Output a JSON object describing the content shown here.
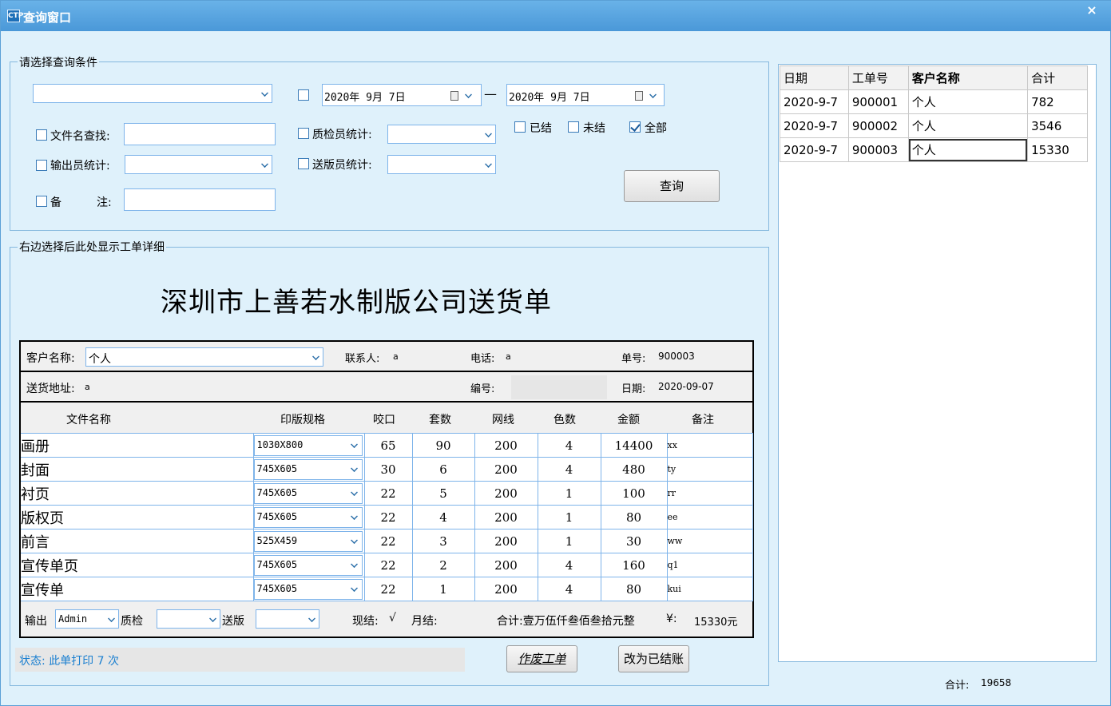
{
  "window": {
    "title": "查询窗口",
    "icon_text": "CTP",
    "close": "×"
  },
  "query": {
    "group_label": "请选择查询条件",
    "date_from": "2020年 9月 7日",
    "date_sep": "—",
    "date_to": "2020年 9月 7日",
    "filename_label": "文件名查找:",
    "qc_label": "质检员统计:",
    "output_label": "输出员统计:",
    "delivery_label": "送版员统计:",
    "remark_label_a": "备",
    "remark_label_b": "注:",
    "settled_label": "已结",
    "unsettled_label": "未结",
    "all_label": "全部",
    "search_button": "查询"
  },
  "detail": {
    "group_label": "右边选择后此处显示工单详细",
    "title": "深圳市上善若水制版公司送货单",
    "customer_label": "客户名称:",
    "customer_value": "个人",
    "contact_label": "联系人:",
    "contact_value": "a",
    "phone_label": "电话:",
    "phone_value": "a",
    "order_no_label": "单号:",
    "order_no_value": "900003",
    "address_label": "送货地址:",
    "address_value": "a",
    "code_label": "编号:",
    "date_label": "日期:",
    "date_value": "2020-09-07",
    "columns": [
      "文件名称",
      "印版规格",
      "咬口",
      "套数",
      "网线",
      "色数",
      "金额",
      "备注"
    ],
    "rows": [
      {
        "name": "画册",
        "spec": "1030X800",
        "bite": "65",
        "sets": "90",
        "screen": "200",
        "colors": "4",
        "amount": "14400",
        "note": "xx"
      },
      {
        "name": "封面",
        "spec": "745X605",
        "bite": "30",
        "sets": "6",
        "screen": "200",
        "colors": "4",
        "amount": "480",
        "note": "ty"
      },
      {
        "name": "衬页",
        "spec": "745X605",
        "bite": "22",
        "sets": "5",
        "screen": "200",
        "colors": "1",
        "amount": "100",
        "note": "rr"
      },
      {
        "name": "版权页",
        "spec": "745X605",
        "bite": "22",
        "sets": "4",
        "screen": "200",
        "colors": "1",
        "amount": "80",
        "note": "ee"
      },
      {
        "name": "前言",
        "spec": "525X459",
        "bite": "22",
        "sets": "3",
        "screen": "200",
        "colors": "1",
        "amount": "30",
        "note": "ww"
      },
      {
        "name": "宣传单页",
        "spec": "745X605",
        "bite": "22",
        "sets": "2",
        "screen": "200",
        "colors": "4",
        "amount": "160",
        "note": "q1"
      },
      {
        "name": "宣传单",
        "spec": "745X605",
        "bite": "22",
        "sets": "1",
        "screen": "200",
        "colors": "4",
        "amount": "80",
        "note": "kui"
      }
    ],
    "footer": {
      "output_label": "输出",
      "output_value": "Admin",
      "qc_label": "质检",
      "delivery_label": "送版",
      "cash_label": "现结:",
      "cash_mark": "√",
      "monthly_label": "月结:",
      "total_cn": "合计:壹万伍仟叁佰叁拾元整",
      "yen_label": "¥:",
      "yen_value": "15330元"
    },
    "status": "状态: 此单打印 7 次",
    "void_button": "作废工单",
    "settle_button": "改为已结账"
  },
  "orders": {
    "columns": [
      "日期",
      "工单号",
      "客户名称",
      "合计"
    ],
    "rows": [
      {
        "date": "2020-9-7",
        "no": "900001",
        "customer": "个人",
        "total": "782"
      },
      {
        "date": "2020-9-7",
        "no": "900002",
        "customer": "个人",
        "total": "3546"
      },
      {
        "date": "2020-9-7",
        "no": "900003",
        "customer": "个人",
        "total": "15330"
      }
    ],
    "total_label": "合计:",
    "total_value": "19658"
  }
}
